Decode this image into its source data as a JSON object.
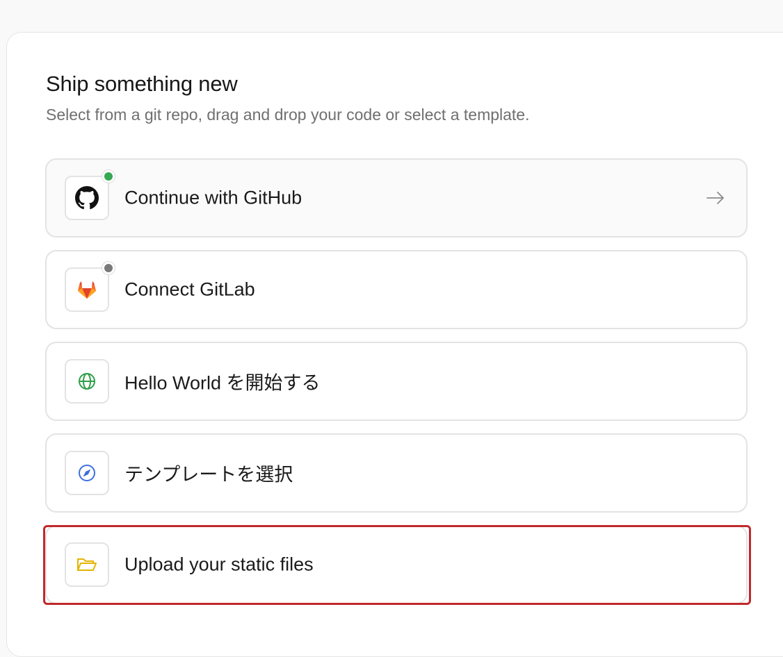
{
  "header": {
    "title": "Ship something new",
    "subtitle": "Select from a git repo, drag and drop your code or select a template."
  },
  "options": [
    {
      "label": "Continue with GitHub",
      "icon": "github-icon",
      "status_color": "#34a853",
      "has_arrow": true
    },
    {
      "label": "Connect GitLab",
      "icon": "gitlab-icon",
      "status_color": "#7a7a7a",
      "has_arrow": false
    },
    {
      "label": "Hello World を開始する",
      "icon": "globe-icon",
      "icon_color": "#2e9e48"
    },
    {
      "label": "テンプレートを選択",
      "icon": "compass-icon",
      "icon_color": "#3b6fe0"
    },
    {
      "label": "Upload your static files",
      "icon": "folder-open-icon",
      "icon_color": "#e3b400",
      "selected": true
    }
  ],
  "colors": {
    "selection_outline": "#c0292b",
    "github_status": "#34a853",
    "gitlab_status": "#7a7a7a"
  }
}
